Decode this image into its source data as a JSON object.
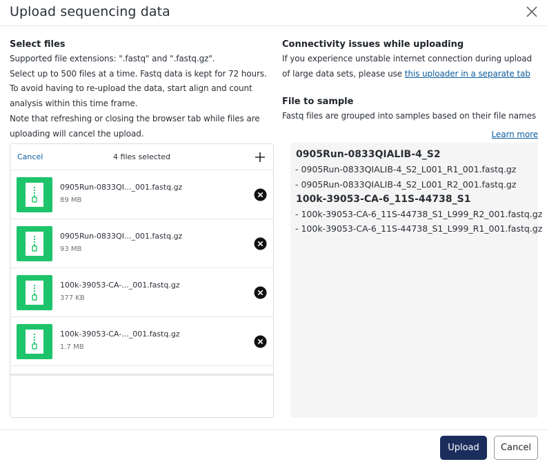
{
  "dialog": {
    "title": "Upload sequencing data"
  },
  "select_files": {
    "heading": "Select files",
    "p1": "Supported file extensions: \".fastq\" and \".fastq.gz\".",
    "p2": "Select up to 500 files at a time. Fastq data is kept for 72 hours. To avoid having to re-upload the data, start align and count analysis within this time frame.",
    "p3": "Note that refreshing or closing the browser tab while files are uploading will cancel the upload."
  },
  "upload_box": {
    "cancel_label": "Cancel",
    "count_label": "4 files selected",
    "files": [
      {
        "name": "0905Run-0833QI..._001.fastq.gz",
        "size": "89 MB"
      },
      {
        "name": "0905Run-0833QI..._001.fastq.gz",
        "size": "93 MB"
      },
      {
        "name": "100k-39053-CA-..._001.fastq.gz",
        "size": "377 KB"
      },
      {
        "name": "100k-39053-CA-..._001.fastq.gz",
        "size": "1.7 MB"
      }
    ]
  },
  "connectivity": {
    "heading": "Connectivity issues while uploading",
    "text_before": "If you experience unstable internet connection during upload of large data sets, please use ",
    "link_text": "this uploader in a separate tab"
  },
  "file_to_sample": {
    "heading": "File to sample",
    "text": "Fastq files are grouped into samples based on their file names",
    "learn_more": "Learn more",
    "groups": [
      {
        "name": "0905Run-0833QIALIB-4_S2",
        "files": [
          "- 0905Run-0833QIALIB-4_S2_L001_R1_001.fastq.gz",
          "- 0905Run-0833QIALIB-4_S2_L001_R2_001.fastq.gz"
        ]
      },
      {
        "name": "100k-39053-CA-6_11S-44738_S1",
        "files": [
          "- 100k-39053-CA-6_11S-44738_S1_L999_R2_001.fastq.gz",
          "- 100k-39053-CA-6_11S-44738_S1_L999_R1_001.fastq.gz"
        ]
      }
    ]
  },
  "footer": {
    "upload_label": "Upload",
    "cancel_label": "Cancel"
  },
  "colors": {
    "brand_green": "#1ec46b",
    "primary_button": "#1b2d5c",
    "link": "#0b5c9e"
  }
}
